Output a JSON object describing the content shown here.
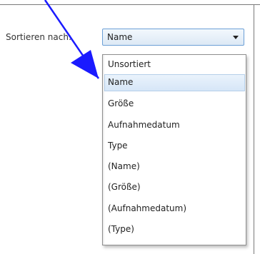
{
  "sort": {
    "label": "Sortieren nach:",
    "selected_value": "Name",
    "dropdown_icon": "chevron-down-icon",
    "options": [
      "Unsortiert",
      "Name",
      "Größe",
      "Aufnahmedatum",
      "Type",
      "(Name)",
      "(Größe)",
      "(Aufnahmedatum)",
      "(Type)"
    ],
    "highlighted_option": "Name"
  },
  "annotation": {
    "arrow_color": "#1a1aff",
    "arrow_icon": "pointer-arrow"
  },
  "colors": {
    "combo_border": "#6b9fd6",
    "selection_fill": "#d6e6f7"
  }
}
